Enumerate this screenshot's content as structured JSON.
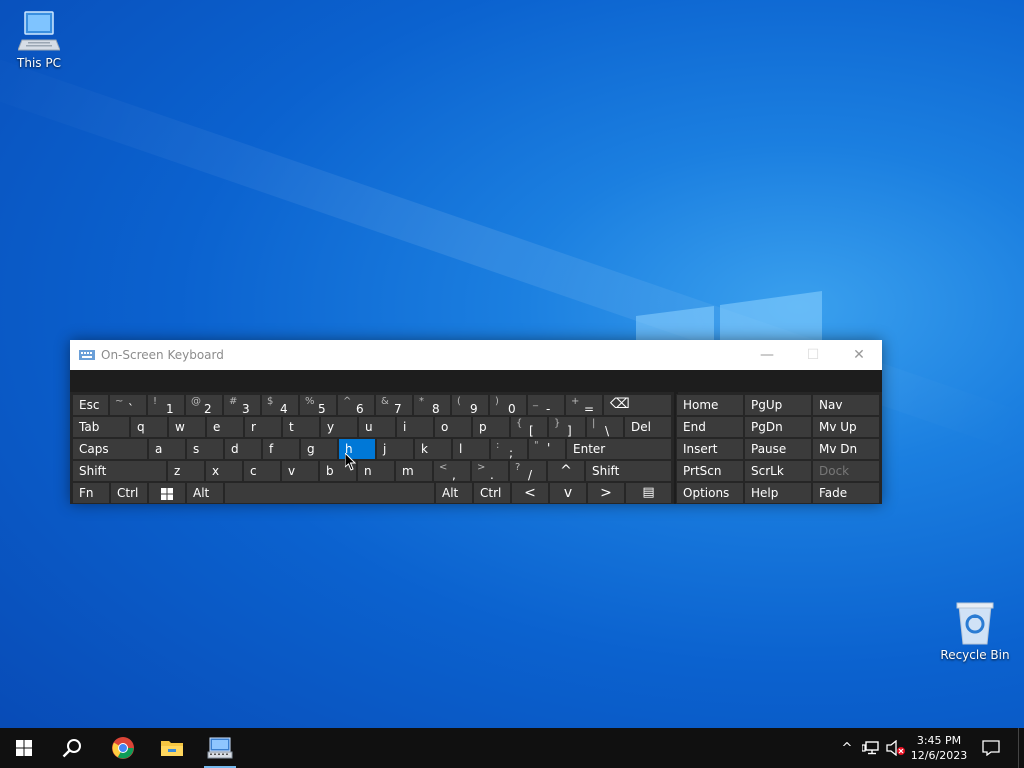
{
  "desktop": {
    "icons": [
      {
        "label": "This PC",
        "icon": "this-pc-icon"
      },
      {
        "label": "Recycle Bin",
        "icon": "recycle-bin-icon"
      }
    ]
  },
  "osk": {
    "title": "On-Screen Keyboard",
    "controls": {
      "minimize": "—",
      "maximize": "☐",
      "close": "✕"
    },
    "active_key": "h",
    "keys": {
      "esc": "Esc",
      "tilde_top": "~",
      "tilde_bot": "`",
      "n1_top": "!",
      "n1": "1",
      "n2_top": "@",
      "n2": "2",
      "n3_top": "#",
      "n3": "3",
      "n4_top": "$",
      "n4": "4",
      "n5_top": "%",
      "n5": "5",
      "n6_top": "^",
      "n6": "6",
      "n7_top": "&",
      "n7": "7",
      "n8_top": "*",
      "n8": "8",
      "n9_top": "(",
      "n9": "9",
      "n0_top": ")",
      "n0": "0",
      "minus_top": "_",
      "minus": "-",
      "plus_top": "+",
      "plus": "=",
      "backspace": "⌫",
      "tab": "Tab",
      "q": "q",
      "w": "w",
      "e": "e",
      "r": "r",
      "t": "t",
      "y": "y",
      "u": "u",
      "i": "i",
      "o": "o",
      "p": "p",
      "lbr_top": "{",
      "lbr": "[",
      "rbr_top": "}",
      "rbr": "]",
      "bs_top": "|",
      "bs": "\\",
      "del": "Del",
      "caps": "Caps",
      "a": "a",
      "s": "s",
      "d": "d",
      "f": "f",
      "g": "g",
      "h": "h",
      "j": "j",
      "k": "k",
      "l": "l",
      "semi_top": ":",
      "semi": ";",
      "quote_top": "\"",
      "quote": "'",
      "enter": "Enter",
      "shift": "Shift",
      "z": "z",
      "x": "x",
      "c": "c",
      "v": "v",
      "b": "b",
      "n": "n",
      "m": "m",
      "comma_top": "<",
      "comma": ",",
      "period_top": ">",
      "period": ".",
      "slash_top": "?",
      "slash": "/",
      "up": "^",
      "rshift": "Shift",
      "fn": "Fn",
      "ctrl": "Ctrl",
      "alt": "Alt",
      "ralt": "Alt",
      "rctrl": "Ctrl",
      "left": "<",
      "down": "v",
      "right": ">",
      "menu": "▤",
      "home": "Home",
      "pgup": "PgUp",
      "nav": "Nav",
      "end": "End",
      "pgdn": "PgDn",
      "mvup": "Mv Up",
      "insert": "Insert",
      "pause": "Pause",
      "mvdn": "Mv Dn",
      "prtscn": "PrtScn",
      "scrlk": "ScrLk",
      "dock": "Dock",
      "options": "Options",
      "help": "Help",
      "fade": "Fade"
    }
  },
  "taskbar": {
    "apps": [
      "start-icon",
      "search-icon",
      "chrome-icon",
      "file-explorer-icon",
      "on-screen-keyboard-icon"
    ],
    "tray": {
      "time": "3:45 PM",
      "date": "12/6/2023",
      "chevron": "^"
    }
  },
  "colors": {
    "accent": "#0078d7",
    "key": "#3b3b3b",
    "osk_bg": "#262626",
    "taskbar": "#101010"
  }
}
